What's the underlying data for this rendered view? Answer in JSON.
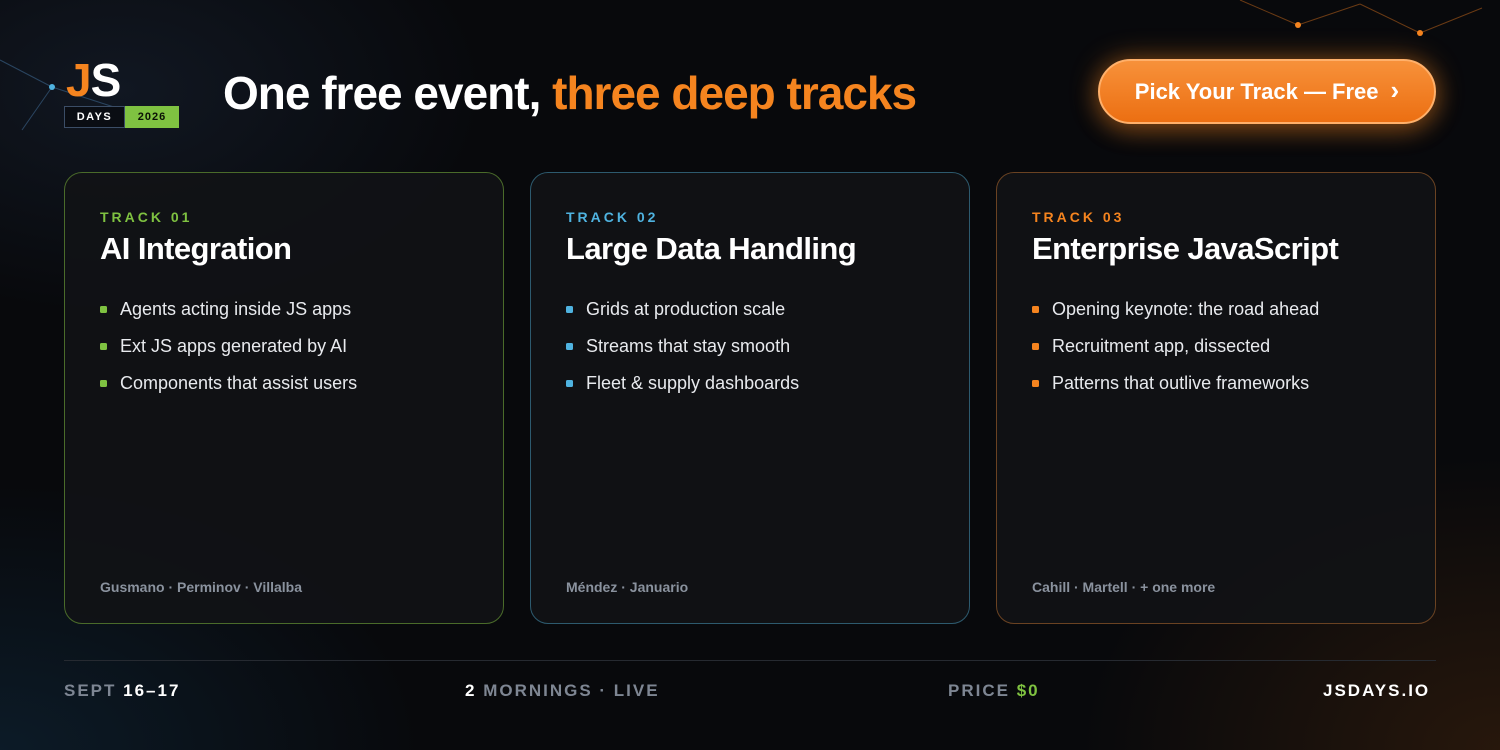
{
  "logo": {
    "js_j": "J",
    "js_s": "S",
    "days": "DAYS",
    "year": "2026"
  },
  "headline": {
    "lead": "One free event, ",
    "accent": "three deep tracks"
  },
  "cta": {
    "label": "Pick Your Track — Free",
    "chevron": "›"
  },
  "tracks": [
    {
      "label": "TRACK 01",
      "title": "AI Integration",
      "bullets": [
        "Agents acting inside JS apps",
        "Ext JS apps generated by AI",
        "Components that assist users"
      ],
      "speakers": "Gusmano · Perminov · Villalba",
      "color": "#7fc241"
    },
    {
      "label": "TRACK 02",
      "title": "Large Data Handling",
      "bullets": [
        "Grids at production scale",
        "Streams that stay smooth",
        "Fleet & supply dashboards"
      ],
      "speakers": "Méndez · Januario",
      "color": "#4fb3e0"
    },
    {
      "label": "TRACK 03",
      "title": "Enterprise JavaScript",
      "bullets": [
        "Opening keynote: the road ahead",
        "Recruitment app, dissected",
        "Patterns that outlive frameworks"
      ],
      "speakers": "Cahill · Martell · + one more",
      "color": "#f5841f"
    }
  ],
  "footer": {
    "date_label": "SEPT ",
    "date_value": "16–17",
    "format_value": "2",
    "format_label": " MORNINGS · LIVE",
    "price_label": "PRICE ",
    "price_value": "$0",
    "site": "JSDAYS.IO"
  },
  "colors": {
    "accent": "#f5841f",
    "green": "#7fc241",
    "blue": "#4fb3e0",
    "background": "#08090c"
  }
}
